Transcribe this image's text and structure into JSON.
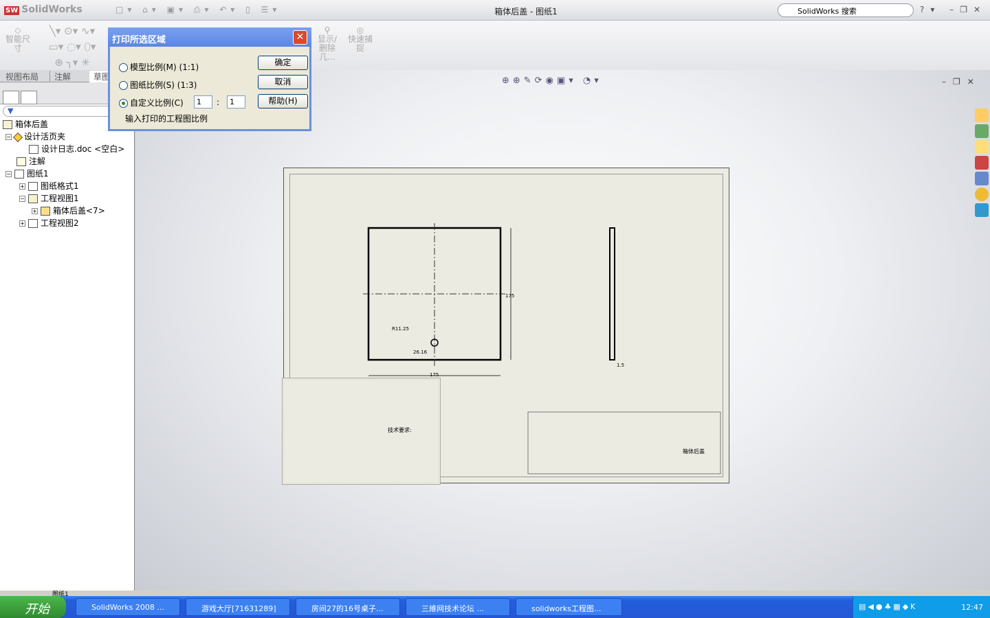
{
  "app": {
    "logo": "SolidWorks",
    "title": "箱体后盖 - 图纸1",
    "search_placeholder": "SolidWorks 搜索"
  },
  "ribbon": {
    "smart_dim": "智能尺寸",
    "show_delete": "显示/删除几...",
    "quick_snap": "快速捕捉"
  },
  "tabs": [
    "视图布局",
    "注解",
    "草图"
  ],
  "tree": [
    {
      "label": "箱体后盖",
      "level": 0
    },
    {
      "label": "设计活页夹",
      "level": 1
    },
    {
      "label": "设计日志.doc <空白>",
      "level": 2
    },
    {
      "label": "注解",
      "level": 1
    },
    {
      "label": "图纸1",
      "level": 1
    },
    {
      "label": "图纸格式1",
      "level": 2
    },
    {
      "label": "工程视图1",
      "level": 2
    },
    {
      "label": "箱体后盖<7>",
      "level": 3
    },
    {
      "label": "工程视图2",
      "level": 2
    }
  ],
  "dialog": {
    "title": "打印所选区域",
    "opt_model": "模型比例(M) (1:1)",
    "opt_sheet": "图纸比例(S) (1:3)",
    "opt_custom": "自定义比例(C)",
    "selected": "custom",
    "custom_num": "1",
    "colon": ":",
    "custom_den": "1",
    "hint": "输入打印的工程图比例",
    "ok": "确定",
    "cancel": "取消",
    "help": "帮助(H)"
  },
  "drawing": {
    "dim_r": "R11.25",
    "dim_w": "175",
    "dim_h": "175",
    "dim_small": "26.16",
    "dim_t": "1.5",
    "notes_title": "技术要求:",
    "part_name": "箱体后盖"
  },
  "status": {
    "sheet_tab": "图纸1"
  },
  "taskbar": {
    "start": "开始",
    "items": [
      "SolidWorks 2008 ...",
      "游戏大厅[71631289]",
      "房间27的16号桌子...",
      "三維网技术论坛 ...",
      "solidworks工程图..."
    ],
    "clock": "12:47"
  }
}
